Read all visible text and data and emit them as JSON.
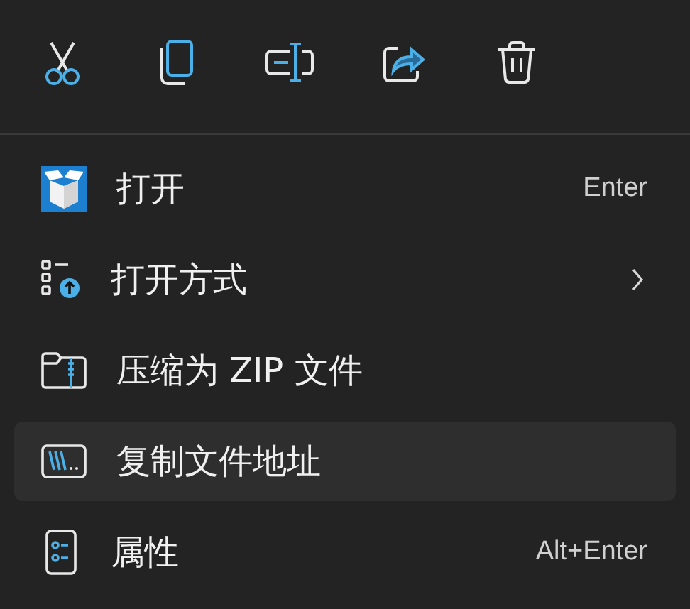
{
  "toolbar": [
    {
      "kind": "cut"
    },
    {
      "kind": "copy"
    },
    {
      "kind": "rename"
    },
    {
      "kind": "share"
    },
    {
      "kind": "delete"
    }
  ],
  "menu": [
    {
      "kind": "open",
      "label": "打开",
      "shortcut": "Enter",
      "submenu": false,
      "selected": false
    },
    {
      "kind": "open-with",
      "label": "打开方式",
      "submenu": true,
      "selected": false
    },
    {
      "kind": "zip",
      "label": "压缩为 ZIP 文件",
      "submenu": false,
      "selected": false
    },
    {
      "kind": "copy-path",
      "label": "复制文件地址",
      "submenu": false,
      "selected": true
    },
    {
      "kind": "properties",
      "label": "属性",
      "shortcut": "Alt+Enter",
      "submenu": false,
      "selected": false
    }
  ]
}
